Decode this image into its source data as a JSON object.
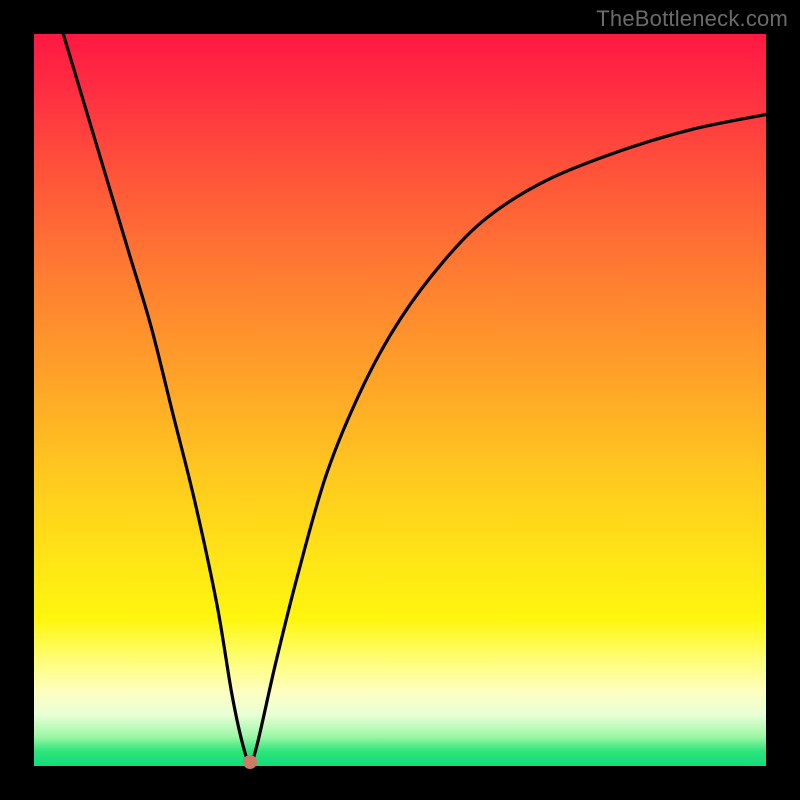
{
  "watermark": "TheBottleneck.com",
  "chart_data": {
    "type": "line",
    "title": "",
    "xlabel": "",
    "ylabel": "",
    "xlim": [
      0,
      100
    ],
    "ylim": [
      0,
      100
    ],
    "grid": false,
    "series": [
      {
        "name": "bottleneck-curve",
        "x": [
          4,
          7,
          10,
          13,
          16,
          19,
          22,
          25,
          27,
          28.5,
          29.5,
          30.5,
          33,
          36,
          40,
          45,
          50,
          56,
          62,
          70,
          80,
          90,
          100
        ],
        "y": [
          100,
          90,
          80,
          70,
          60,
          48,
          36,
          22,
          10,
          3,
          0.5,
          3,
          14,
          26,
          40,
          52,
          61,
          69,
          75,
          80,
          84,
          87,
          89
        ]
      }
    ],
    "marker": {
      "x": 29.5,
      "y": 0.5,
      "color": "#cc7b66"
    },
    "gradient_stops": [
      {
        "pos": 0,
        "color": "#ff1842"
      },
      {
        "pos": 8,
        "color": "#ff2f42"
      },
      {
        "pos": 18,
        "color": "#ff503a"
      },
      {
        "pos": 32,
        "color": "#ff7a32"
      },
      {
        "pos": 46,
        "color": "#ffa029"
      },
      {
        "pos": 60,
        "color": "#ffc81f"
      },
      {
        "pos": 72,
        "color": "#ffe516"
      },
      {
        "pos": 80,
        "color": "#fff60f"
      },
      {
        "pos": 85,
        "color": "#fffd6e"
      },
      {
        "pos": 90,
        "color": "#fdffc2"
      },
      {
        "pos": 93,
        "color": "#e8ffd6"
      },
      {
        "pos": 96,
        "color": "#9cf7a6"
      },
      {
        "pos": 98,
        "color": "#2de57a"
      },
      {
        "pos": 100,
        "color": "#14db7c"
      }
    ]
  }
}
